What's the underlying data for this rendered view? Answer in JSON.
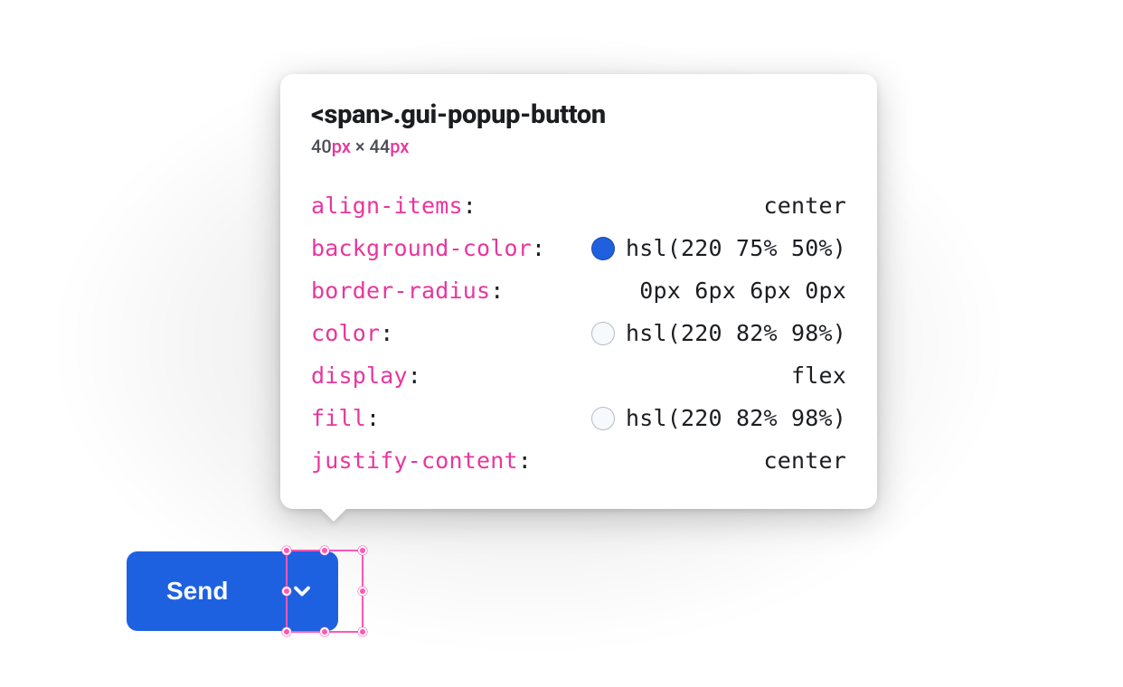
{
  "tooltip": {
    "title": "<span>.gui-popup-button",
    "dim_w": "40",
    "dim_h": "44",
    "px_unit": "px",
    "times": " × ",
    "props": [
      {
        "key": "align-items",
        "value": "center",
        "swatch": null
      },
      {
        "key": "background-color",
        "value": "hsl(220 75% 50%)",
        "swatch": "#2060df"
      },
      {
        "key": "border-radius",
        "value": "0px 6px 6px 0px",
        "swatch": null
      },
      {
        "key": "color",
        "value": "hsl(220 82% 98%)",
        "swatch": "#f6f9fe"
      },
      {
        "key": "display",
        "value": "flex",
        "swatch": null
      },
      {
        "key": "fill",
        "value": "hsl(220 82% 98%)",
        "swatch": "#f6f9fe"
      },
      {
        "key": "justify-content",
        "value": "center",
        "swatch": null
      }
    ]
  },
  "button": {
    "main_label": "Send",
    "popup_icon_name": "chevron-down-icon"
  },
  "colors": {
    "accent_blue": "#1e61e0",
    "selection_pink": "#ff57b5",
    "css_key_pink": "#e8369e"
  }
}
